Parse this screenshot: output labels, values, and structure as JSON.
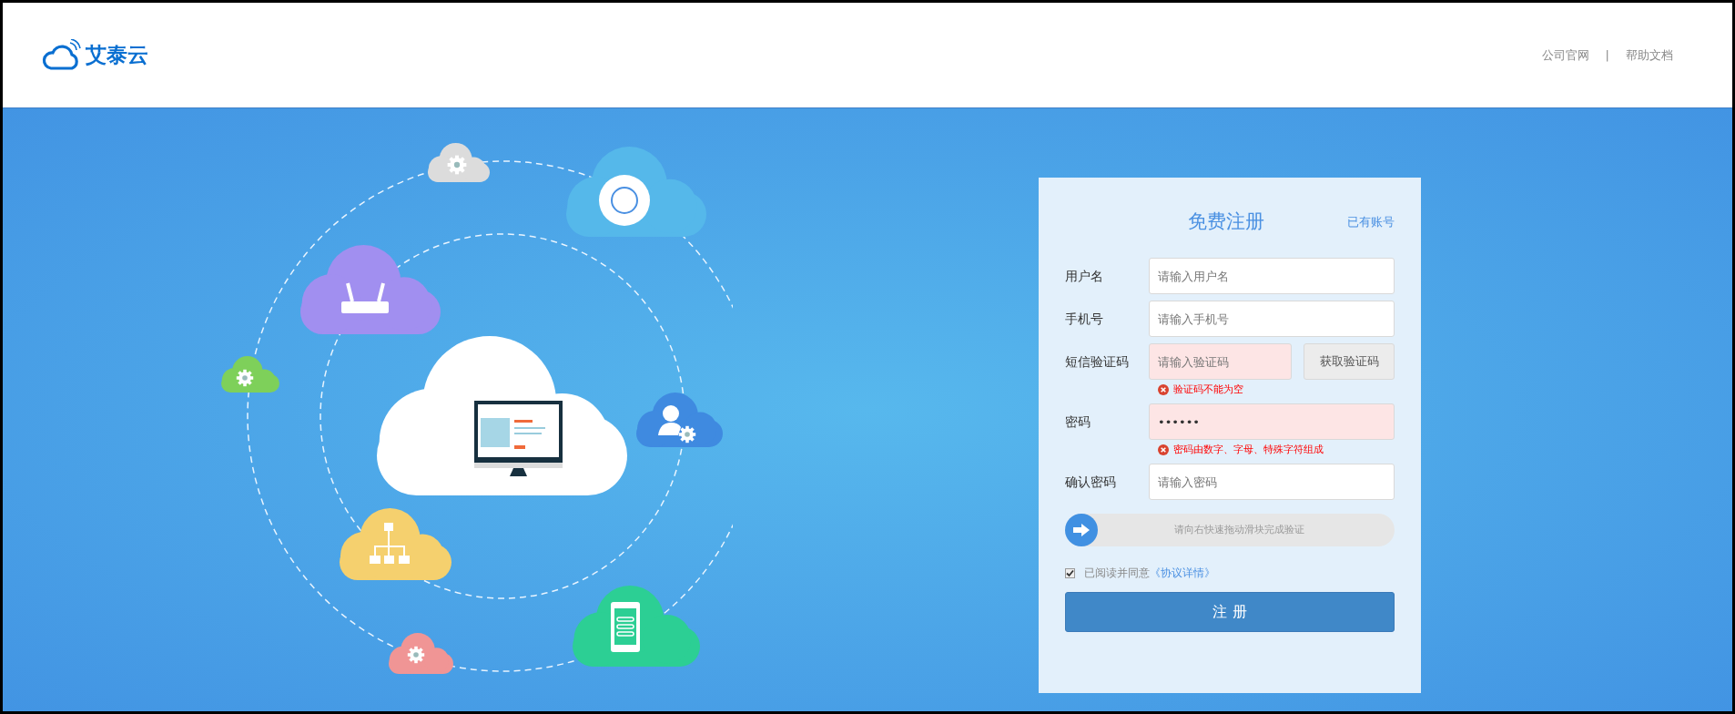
{
  "header": {
    "logo": "艾泰云",
    "links": [
      "公司官网",
      "帮助文档"
    ],
    "separator": "|"
  },
  "form": {
    "title": "免费注册",
    "login_link": "已有账号",
    "fields": [
      {
        "kind": "text",
        "label": "用户名",
        "placeholder": "请输入用户名",
        "invalid": false
      },
      {
        "kind": "text",
        "label": "手机号",
        "placeholder": "请输入手机号",
        "invalid": false
      },
      {
        "kind": "code",
        "label": "短信验证码",
        "placeholder": "请输入验证码",
        "invalid": true,
        "error": "验证码不能为空",
        "button": "获取验证码"
      },
      {
        "kind": "password",
        "label": "密码",
        "value": "••••••",
        "invalid": true,
        "error": "密码由数字、字母、特殊字符组成"
      },
      {
        "kind": "text",
        "label": "确认密码",
        "placeholder": "请输入密码",
        "invalid": false
      }
    ],
    "slider": {
      "text": "请向右快速拖动滑块完成验证",
      "level": 0
    },
    "agreement": {
      "checked": true,
      "text": "已阅读并同意",
      "link": "《协议详情》"
    },
    "submit": "注 册"
  }
}
